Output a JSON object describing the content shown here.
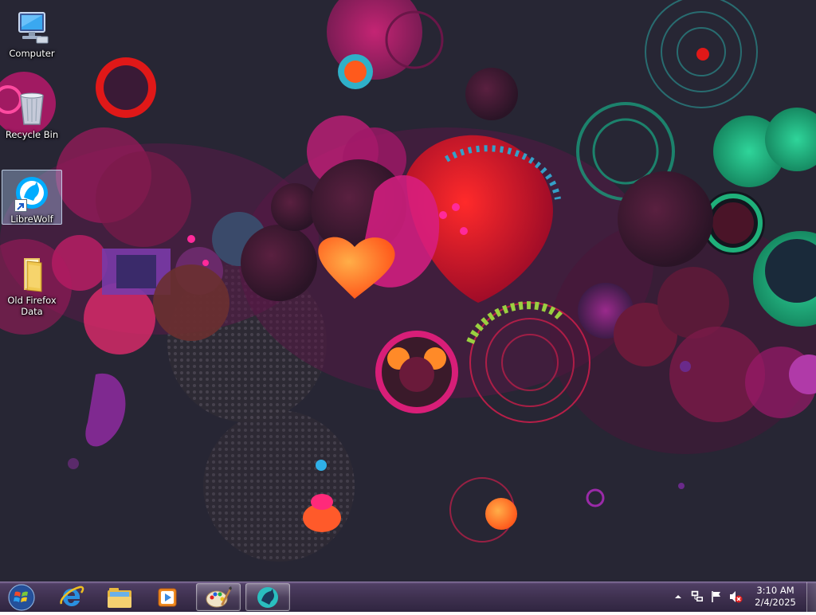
{
  "desktop": {
    "icons": [
      {
        "label": "Computer",
        "icon": "computer-icon"
      },
      {
        "label": "Recycle Bin",
        "icon": "recycle-bin-icon"
      },
      {
        "label": "LibreWolf",
        "icon": "librewolf-icon",
        "selected": true,
        "shortcut": true
      },
      {
        "label": "Old Firefox Data",
        "icon": "folder-icon"
      }
    ]
  },
  "taskbar": {
    "start": {
      "icon": "windows-start-icon"
    },
    "pinned": [
      {
        "name": "Internet Explorer",
        "icon": "internet-explorer-icon",
        "open": false
      },
      {
        "name": "Windows Explorer",
        "icon": "file-explorer-icon",
        "open": false
      },
      {
        "name": "Windows Media Player",
        "icon": "media-player-icon",
        "open": false
      },
      {
        "name": "Paint",
        "icon": "paint-icon",
        "open": true
      },
      {
        "name": "LibreWolf",
        "icon": "librewolf-icon",
        "open": true
      }
    ],
    "tray": {
      "icons": [
        "show-hidden-icons-chevron",
        "network-icon",
        "action-center-flag-icon",
        "volume-muted-icon"
      ],
      "time": "3:10 AM",
      "date": "2/4/2025"
    }
  },
  "colors": {
    "wallpaper_base": "#272634",
    "taskbar": "#3f3150",
    "accent_pink": "#d8127a",
    "accent_red": "#e01818",
    "accent_orange": "#ff7a28",
    "accent_green": "#27c48a",
    "accent_purple": "#7b2a8a"
  }
}
